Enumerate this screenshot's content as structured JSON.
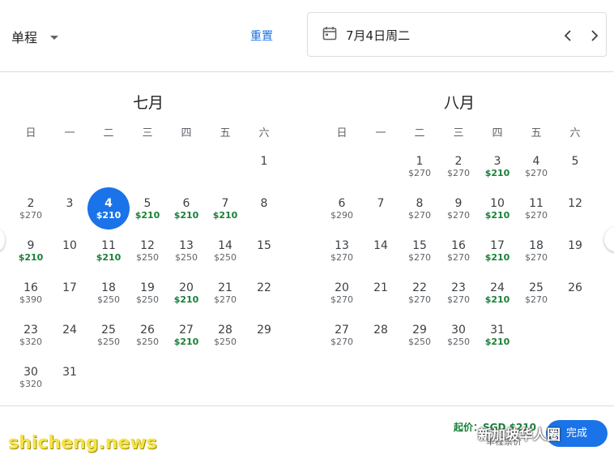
{
  "header": {
    "trip_type": "单程",
    "reset": "重置",
    "date": "7月4日周二"
  },
  "weekdays": [
    "日",
    "一",
    "二",
    "三",
    "四",
    "五",
    "六"
  ],
  "months": [
    {
      "title": "七月",
      "days": [
        {
          "d": "1",
          "p": ""
        },
        {
          "d": "2",
          "p": "$270"
        },
        {
          "d": "3",
          "p": ""
        },
        {
          "d": "4",
          "p": "$210",
          "low": true,
          "selected": true
        },
        {
          "d": "5",
          "p": "$210",
          "low": true
        },
        {
          "d": "6",
          "p": "$210",
          "low": true
        },
        {
          "d": "7",
          "p": "$210",
          "low": true
        },
        {
          "d": "8",
          "p": ""
        },
        {
          "d": "9",
          "p": "$210",
          "low": true
        },
        {
          "d": "10",
          "p": ""
        },
        {
          "d": "11",
          "p": "$210",
          "low": true
        },
        {
          "d": "12",
          "p": "$250"
        },
        {
          "d": "13",
          "p": "$250"
        },
        {
          "d": "14",
          "p": "$250"
        },
        {
          "d": "15",
          "p": ""
        },
        {
          "d": "16",
          "p": "$390"
        },
        {
          "d": "17",
          "p": ""
        },
        {
          "d": "18",
          "p": "$250"
        },
        {
          "d": "19",
          "p": "$250"
        },
        {
          "d": "20",
          "p": "$210",
          "low": true
        },
        {
          "d": "21",
          "p": "$270"
        },
        {
          "d": "22",
          "p": ""
        },
        {
          "d": "23",
          "p": "$320"
        },
        {
          "d": "24",
          "p": ""
        },
        {
          "d": "25",
          "p": "$250"
        },
        {
          "d": "26",
          "p": "$250"
        },
        {
          "d": "27",
          "p": "$210",
          "low": true
        },
        {
          "d": "28",
          "p": "$250"
        },
        {
          "d": "29",
          "p": ""
        },
        {
          "d": "30",
          "p": "$320"
        },
        {
          "d": "31",
          "p": ""
        }
      ]
    },
    {
      "title": "八月",
      "days": [
        {
          "d": "1",
          "p": "$270"
        },
        {
          "d": "2",
          "p": "$270"
        },
        {
          "d": "3",
          "p": "$210",
          "low": true
        },
        {
          "d": "4",
          "p": "$270"
        },
        {
          "d": "5",
          "p": ""
        },
        {
          "d": "6",
          "p": "$290"
        },
        {
          "d": "7",
          "p": ""
        },
        {
          "d": "8",
          "p": "$270"
        },
        {
          "d": "9",
          "p": "$270"
        },
        {
          "d": "10",
          "p": "$210",
          "low": true
        },
        {
          "d": "11",
          "p": "$270"
        },
        {
          "d": "12",
          "p": ""
        },
        {
          "d": "13",
          "p": "$270"
        },
        {
          "d": "14",
          "p": ""
        },
        {
          "d": "15",
          "p": "$270"
        },
        {
          "d": "16",
          "p": "$270"
        },
        {
          "d": "17",
          "p": "$210",
          "low": true
        },
        {
          "d": "18",
          "p": "$270"
        },
        {
          "d": "19",
          "p": ""
        },
        {
          "d": "20",
          "p": "$270"
        },
        {
          "d": "21",
          "p": ""
        },
        {
          "d": "22",
          "p": "$270"
        },
        {
          "d": "23",
          "p": "$270"
        },
        {
          "d": "24",
          "p": "$210",
          "low": true
        },
        {
          "d": "25",
          "p": "$270"
        },
        {
          "d": "26",
          "p": ""
        },
        {
          "d": "27",
          "p": "$270"
        },
        {
          "d": "28",
          "p": ""
        },
        {
          "d": "29",
          "p": "$250"
        },
        {
          "d": "30",
          "p": "$250"
        },
        {
          "d": "31",
          "p": "$210",
          "low": true
        }
      ]
    }
  ],
  "footer": {
    "from_price": "起价：SGD $210",
    "price_note": "单程票价",
    "done": "完成"
  },
  "watermarks": {
    "channel": "新加坡华人圈",
    "site": "shicheng.news"
  },
  "colors": {
    "accent": "#1a73e8",
    "low_price": "#188038"
  },
  "icons": [
    "calendar-icon",
    "chevron-left-icon",
    "chevron-right-icon",
    "dropdown-caret-icon"
  ]
}
